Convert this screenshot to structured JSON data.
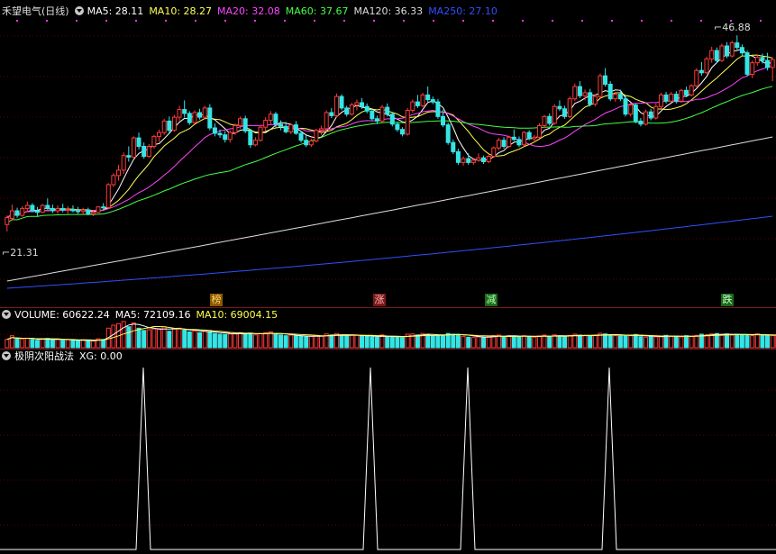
{
  "colors": {
    "up": "#ff3b3b",
    "down": "#35e5e5",
    "ma5": "#ffffff",
    "ma10": "#ffff55",
    "ma20": "#ff44ff",
    "ma60": "#44ff44",
    "ma120": "#dddddd",
    "ma250": "#3050ff",
    "grid": "#5a0000"
  },
  "main": {
    "stock_name": "禾望电气(日线)",
    "ma5_label": "MA5: 28.11",
    "ma10_label": "MA10: 28.27",
    "ma20_label": "MA20: 32.08",
    "ma60_label": "MA60: 37.67",
    "ma120_label": "MA120: 36.33",
    "ma250_label": "MA250: 27.10",
    "high_label": "46.88",
    "low_label": "21.31",
    "signals": [
      "榜",
      "涨",
      "减",
      "跌"
    ]
  },
  "volume": {
    "vol_label": "VOLUME: 60622.24",
    "ma5_label": "MA5: 72109.16",
    "ma10_label": "MA10: 69004.15"
  },
  "indicator": {
    "name": "极阴次阳战法",
    "xg_label": "XG: 0.00",
    "signal_count": 4
  },
  "chart_data": {
    "type": "candlestick",
    "y_range": [
      21.31,
      46.88
    ],
    "ohlc": [
      [
        22.2,
        23.4,
        21.3,
        23.1
      ],
      [
        23.0,
        24.8,
        22.7,
        24.0
      ],
      [
        24.0,
        24.4,
        23.1,
        23.4
      ],
      [
        23.4,
        24.6,
        23.2,
        24.3
      ],
      [
        24.3,
        25.2,
        23.9,
        24.7
      ],
      [
        24.7,
        25.0,
        23.8,
        24.0
      ],
      [
        24.0,
        24.5,
        23.2,
        23.8
      ],
      [
        23.8,
        24.9,
        23.7,
        24.7
      ],
      [
        24.7,
        25.6,
        24.1,
        24.3
      ],
      [
        24.3,
        24.8,
        23.7,
        24.0
      ],
      [
        24.0,
        24.7,
        23.6,
        24.3
      ],
      [
        24.3,
        24.9,
        23.8,
        24.1
      ],
      [
        24.1,
        24.6,
        23.6,
        24.2
      ],
      [
        24.2,
        24.7,
        23.8,
        24.0
      ],
      [
        24.0,
        24.5,
        23.6,
        23.9
      ],
      [
        23.9,
        24.4,
        23.5,
        24.1
      ],
      [
        24.1,
        24.4,
        23.4,
        23.6
      ],
      [
        23.6,
        24.0,
        23.3,
        23.8
      ],
      [
        23.8,
        24.6,
        23.7,
        24.5
      ],
      [
        24.5,
        25.0,
        24.1,
        24.4
      ],
      [
        24.4,
        27.6,
        24.3,
        27.4
      ],
      [
        27.4,
        28.9,
        27.1,
        28.6
      ],
      [
        28.6,
        30.0,
        27.9,
        29.3
      ],
      [
        29.3,
        31.6,
        28.8,
        31.2
      ],
      [
        31.2,
        32.4,
        30.4,
        31.0
      ],
      [
        31.0,
        33.7,
        30.9,
        33.5
      ],
      [
        33.5,
        34.2,
        32.0,
        32.4
      ],
      [
        32.4,
        32.9,
        30.8,
        31.1
      ],
      [
        31.1,
        32.7,
        30.9,
        32.4
      ],
      [
        32.4,
        33.9,
        32.1,
        33.7
      ],
      [
        33.7,
        34.6,
        33.0,
        34.2
      ],
      [
        34.2,
        36.0,
        33.9,
        35.7
      ],
      [
        35.7,
        36.3,
        34.0,
        34.5
      ],
      [
        34.5,
        36.5,
        34.3,
        36.2
      ],
      [
        36.2,
        37.7,
        35.7,
        37.2
      ],
      [
        37.2,
        38.4,
        36.2,
        36.7
      ],
      [
        36.7,
        37.0,
        35.2,
        35.5
      ],
      [
        35.5,
        37.1,
        35.3,
        36.8
      ],
      [
        36.8,
        37.3,
        35.9,
        36.2
      ],
      [
        36.2,
        37.7,
        35.9,
        37.4
      ],
      [
        37.4,
        37.9,
        34.5,
        34.8
      ],
      [
        34.8,
        35.4,
        33.7,
        34.1
      ],
      [
        34.1,
        34.6,
        33.5,
        33.9
      ],
      [
        33.9,
        34.4,
        32.9,
        33.3
      ],
      [
        33.3,
        34.5,
        32.9,
        34.2
      ],
      [
        34.2,
        35.4,
        33.9,
        35.1
      ],
      [
        35.1,
        36.3,
        34.7,
        36.0
      ],
      [
        36.0,
        36.4,
        34.1,
        34.4
      ],
      [
        34.4,
        34.7,
        32.2,
        32.6
      ],
      [
        32.6,
        33.6,
        32.4,
        33.2
      ],
      [
        33.2,
        35.2,
        33.0,
        34.9
      ],
      [
        34.9,
        36.2,
        34.4,
        35.8
      ],
      [
        35.8,
        37.0,
        35.3,
        36.6
      ],
      [
        36.6,
        36.9,
        34.9,
        35.3
      ],
      [
        35.3,
        35.8,
        34.5,
        35.0
      ],
      [
        35.0,
        35.6,
        34.1,
        34.3
      ],
      [
        34.3,
        35.4,
        34.0,
        35.2
      ],
      [
        35.2,
        35.7,
        33.9,
        34.1
      ],
      [
        34.1,
        34.4,
        32.9,
        33.2
      ],
      [
        33.2,
        33.8,
        32.3,
        32.6
      ],
      [
        32.6,
        33.4,
        32.3,
        33.1
      ],
      [
        33.1,
        34.7,
        32.9,
        34.5
      ],
      [
        34.5,
        35.1,
        33.9,
        34.7
      ],
      [
        34.7,
        37.1,
        34.4,
        36.8
      ],
      [
        36.8,
        37.4,
        36.1,
        36.4
      ],
      [
        36.4,
        39.3,
        36.2,
        38.9
      ],
      [
        38.9,
        39.2,
        37.1,
        37.4
      ],
      [
        37.4,
        37.7,
        36.3,
        36.6
      ],
      [
        36.6,
        38.1,
        36.4,
        37.8
      ],
      [
        37.8,
        38.5,
        37.1,
        38.1
      ],
      [
        38.1,
        38.7,
        37.3,
        37.6
      ],
      [
        37.6,
        38.0,
        36.7,
        37.0
      ],
      [
        37.0,
        37.3,
        35.8,
        36.0
      ],
      [
        36.0,
        36.4,
        35.3,
        35.7
      ],
      [
        35.7,
        37.8,
        35.5,
        37.5
      ],
      [
        37.5,
        38.0,
        36.3,
        36.6
      ],
      [
        36.6,
        36.9,
        35.0,
        35.3
      ],
      [
        35.3,
        35.6,
        34.3,
        34.6
      ],
      [
        34.6,
        34.9,
        33.7,
        34.0
      ],
      [
        34.0,
        37.4,
        33.8,
        37.1
      ],
      [
        37.1,
        38.5,
        36.8,
        38.2
      ],
      [
        38.2,
        39.1,
        37.4,
        37.7
      ],
      [
        37.7,
        39.4,
        37.5,
        39.1
      ],
      [
        39.1,
        40.2,
        38.2,
        38.5
      ],
      [
        38.5,
        38.9,
        37.9,
        38.2
      ],
      [
        38.2,
        38.6,
        36.0,
        36.3
      ],
      [
        36.3,
        37.2,
        34.9,
        35.2
      ],
      [
        35.2,
        35.5,
        32.6,
        32.9
      ],
      [
        32.9,
        33.3,
        31.4,
        31.7
      ],
      [
        31.7,
        32.1,
        30.0,
        30.3
      ],
      [
        30.3,
        31.1,
        29.9,
        30.8
      ],
      [
        30.8,
        31.5,
        30.0,
        30.3
      ],
      [
        30.3,
        30.9,
        30.0,
        30.6
      ],
      [
        30.6,
        31.5,
        30.4,
        30.9
      ],
      [
        30.9,
        31.2,
        30.1,
        30.4
      ],
      [
        30.4,
        31.3,
        30.2,
        31.1
      ],
      [
        31.1,
        32.4,
        30.9,
        32.2
      ],
      [
        32.2,
        33.5,
        31.9,
        33.2
      ],
      [
        33.2,
        33.6,
        32.1,
        32.4
      ],
      [
        32.4,
        33.8,
        32.2,
        33.6
      ],
      [
        33.6,
        34.6,
        33.1,
        33.3
      ],
      [
        33.3,
        33.7,
        32.3,
        32.6
      ],
      [
        32.6,
        34.4,
        32.4,
        34.2
      ],
      [
        34.2,
        34.5,
        33.2,
        33.4
      ],
      [
        33.4,
        33.9,
        32.9,
        33.6
      ],
      [
        33.6,
        35.4,
        33.4,
        35.1
      ],
      [
        35.1,
        36.5,
        34.8,
        36.3
      ],
      [
        36.3,
        36.7,
        35.1,
        35.4
      ],
      [
        35.4,
        37.9,
        35.2,
        37.6
      ],
      [
        37.6,
        38.4,
        37.0,
        37.3
      ],
      [
        37.3,
        37.7,
        36.0,
        36.3
      ],
      [
        36.3,
        38.9,
        36.1,
        38.6
      ],
      [
        38.6,
        40.6,
        38.3,
        40.2
      ],
      [
        40.2,
        40.9,
        38.7,
        39.0
      ],
      [
        39.0,
        39.8,
        38.4,
        39.4
      ],
      [
        39.4,
        39.9,
        37.6,
        37.9
      ],
      [
        37.9,
        39.2,
        37.6,
        38.9
      ],
      [
        38.9,
        41.9,
        38.7,
        41.6
      ],
      [
        41.6,
        42.6,
        40.2,
        40.5
      ],
      [
        40.5,
        40.9,
        38.3,
        38.6
      ],
      [
        38.6,
        39.5,
        38.2,
        39.2
      ],
      [
        39.2,
        39.8,
        38.3,
        38.6
      ],
      [
        38.6,
        39.0,
        36.3,
        36.6
      ],
      [
        36.6,
        38.1,
        36.3,
        37.8
      ],
      [
        37.8,
        38.0,
        35.4,
        35.7
      ],
      [
        35.7,
        36.1,
        35.0,
        35.3
      ],
      [
        35.3,
        37.2,
        35.1,
        36.9
      ],
      [
        36.9,
        37.3,
        35.8,
        36.1
      ],
      [
        36.1,
        38.0,
        35.9,
        37.6
      ],
      [
        37.6,
        39.4,
        37.3,
        39.1
      ],
      [
        39.1,
        39.5,
        38.0,
        38.3
      ],
      [
        38.3,
        39.5,
        38.1,
        39.2
      ],
      [
        39.2,
        39.6,
        38.0,
        38.3
      ],
      [
        38.3,
        39.9,
        38.1,
        39.7
      ],
      [
        39.7,
        40.2,
        38.8,
        39.1
      ],
      [
        39.1,
        40.5,
        38.9,
        40.3
      ],
      [
        40.3,
        42.6,
        40.1,
        42.3
      ],
      [
        42.3,
        43.4,
        41.6,
        42.0
      ],
      [
        42.0,
        44.1,
        41.8,
        43.8
      ],
      [
        43.8,
        45.4,
        43.3,
        44.9
      ],
      [
        44.9,
        45.3,
        43.3,
        43.6
      ],
      [
        43.6,
        45.8,
        43.4,
        45.5
      ],
      [
        45.5,
        46.0,
        43.9,
        44.2
      ],
      [
        44.2,
        46.2,
        44.0,
        45.9
      ],
      [
        45.9,
        46.88,
        45.0,
        45.3
      ],
      [
        45.3,
        45.7,
        44.2,
        44.6
      ],
      [
        44.6,
        44.9,
        41.5,
        41.8
      ],
      [
        41.8,
        43.6,
        41.3,
        43.3
      ],
      [
        43.3,
        44.4,
        42.9,
        44.0
      ],
      [
        44.0,
        44.5,
        43.2,
        43.6
      ],
      [
        43.6,
        44.6,
        42.3,
        42.7
      ],
      [
        42.7,
        44.0,
        40.9,
        43.7
      ]
    ],
    "volume": [
      55,
      80,
      60,
      58,
      62,
      55,
      50,
      58,
      62,
      52,
      55,
      50,
      53,
      48,
      47,
      52,
      46,
      45,
      60,
      55,
      130,
      150,
      160,
      175,
      140,
      165,
      130,
      115,
      120,
      125,
      128,
      140,
      110,
      125,
      130,
      118,
      105,
      112,
      100,
      110,
      108,
      95,
      90,
      88,
      92,
      96,
      100,
      90,
      98,
      85,
      95,
      100,
      105,
      90,
      85,
      80,
      84,
      78,
      75,
      72,
      76,
      80,
      78,
      92,
      85,
      95,
      82,
      78,
      85,
      82,
      78,
      75,
      72,
      70,
      85,
      75,
      72,
      70,
      68,
      90,
      92,
      85,
      95,
      88,
      80,
      85,
      82,
      95,
      90,
      88,
      76,
      70,
      68,
      72,
      70,
      74,
      80,
      84,
      76,
      80,
      78,
      72,
      80,
      74,
      70,
      78,
      84,
      76,
      85,
      78,
      74,
      82,
      90,
      84,
      80,
      78,
      84,
      96,
      92,
      86,
      80,
      78,
      84,
      80,
      88,
      74,
      70,
      78,
      72,
      76,
      82,
      74,
      78,
      72,
      80,
      76,
      82,
      90,
      86,
      92,
      95,
      85,
      92,
      84,
      90,
      88,
      84,
      80,
      92,
      85,
      82,
      80,
      78,
      76
    ]
  }
}
